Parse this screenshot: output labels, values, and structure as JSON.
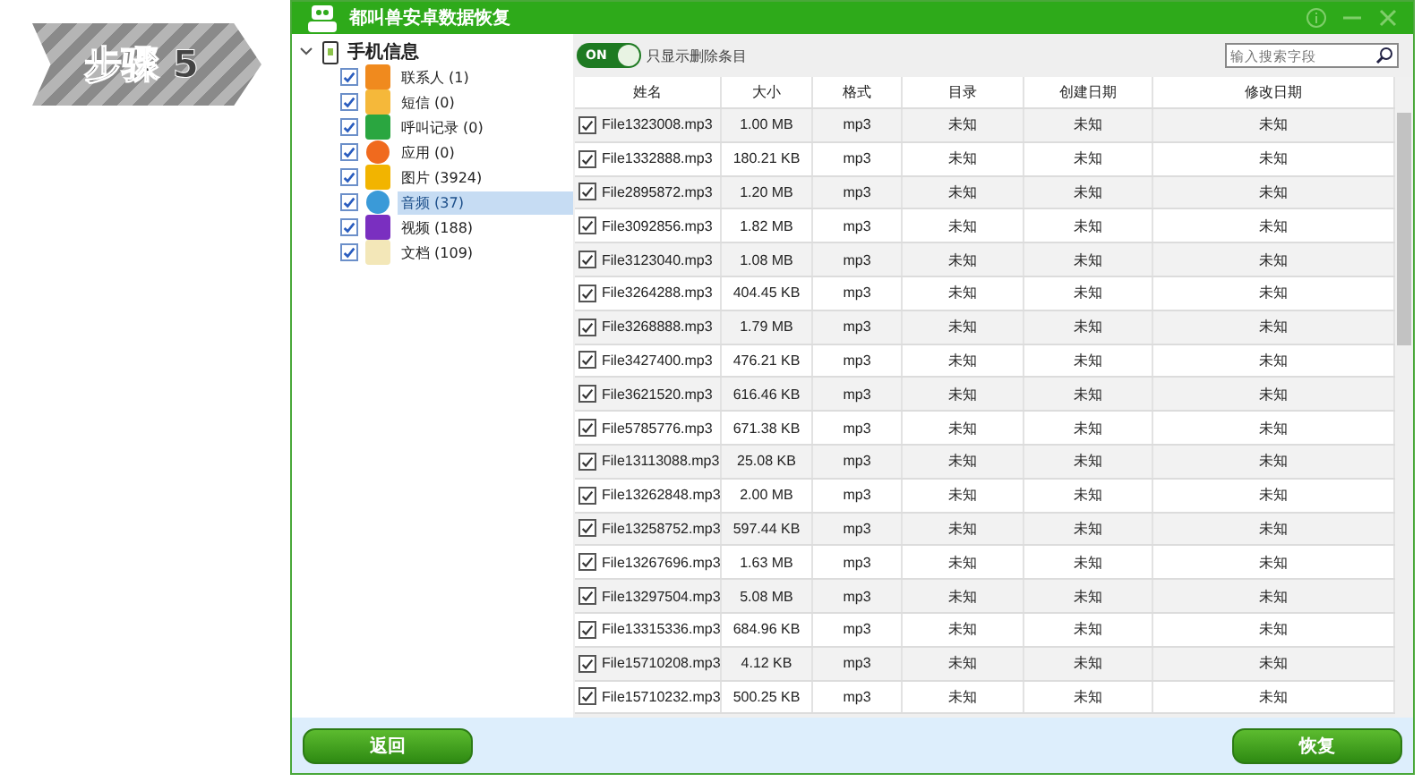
{
  "step_badge": {
    "label": "步骤 5"
  },
  "window": {
    "title": "都叫兽安卓数据恢复"
  },
  "tree": {
    "label": "手机信息",
    "expanded": true,
    "children": [
      {
        "label": "联系人 (1)",
        "kind": "contacts",
        "checked": true,
        "selected": false
      },
      {
        "label": "短信 (0)",
        "kind": "messages",
        "checked": true,
        "selected": false
      },
      {
        "label": "呼叫记录 (0)",
        "kind": "calls",
        "checked": true,
        "selected": false
      },
      {
        "label": "应用 (0)",
        "kind": "apps",
        "checked": true,
        "selected": false
      },
      {
        "label": "图片 (3924)",
        "kind": "photos",
        "checked": true,
        "selected": false
      },
      {
        "label": "音频 (37)",
        "kind": "audio",
        "checked": true,
        "selected": true
      },
      {
        "label": "视频 (188)",
        "kind": "video",
        "checked": true,
        "selected": false
      },
      {
        "label": "文档 (109)",
        "kind": "documents",
        "checked": true,
        "selected": false
      }
    ]
  },
  "filter": {
    "toggle_label": "ON",
    "on": true,
    "label": "只显示删除条目"
  },
  "search": {
    "placeholder": "输入搜索字段"
  },
  "table": {
    "columns": [
      "姓名",
      "大小",
      "格式",
      "目录",
      "创建日期",
      "修改日期"
    ],
    "rows": [
      {
        "checked": true,
        "cells": [
          "File1323008.mp3",
          "1.00 MB",
          "mp3",
          "未知",
          "未知",
          "未知"
        ]
      },
      {
        "checked": true,
        "cells": [
          "File1332888.mp3",
          "180.21 KB",
          "mp3",
          "未知",
          "未知",
          "未知"
        ]
      },
      {
        "checked": true,
        "cells": [
          "File2895872.mp3",
          "1.20 MB",
          "mp3",
          "未知",
          "未知",
          "未知"
        ]
      },
      {
        "checked": true,
        "cells": [
          "File3092856.mp3",
          "1.82 MB",
          "mp3",
          "未知",
          "未知",
          "未知"
        ]
      },
      {
        "checked": true,
        "cells": [
          "File3123040.mp3",
          "1.08 MB",
          "mp3",
          "未知",
          "未知",
          "未知"
        ]
      },
      {
        "checked": true,
        "cells": [
          "File3264288.mp3",
          "404.45 KB",
          "mp3",
          "未知",
          "未知",
          "未知"
        ]
      },
      {
        "checked": true,
        "cells": [
          "File3268888.mp3",
          "1.79 MB",
          "mp3",
          "未知",
          "未知",
          "未知"
        ]
      },
      {
        "checked": true,
        "cells": [
          "File3427400.mp3",
          "476.21 KB",
          "mp3",
          "未知",
          "未知",
          "未知"
        ]
      },
      {
        "checked": true,
        "cells": [
          "File3621520.mp3",
          "616.46 KB",
          "mp3",
          "未知",
          "未知",
          "未知"
        ]
      },
      {
        "checked": true,
        "cells": [
          "File5785776.mp3",
          "671.38 KB",
          "mp3",
          "未知",
          "未知",
          "未知"
        ]
      },
      {
        "checked": true,
        "cells": [
          "File13113088.mp3",
          "25.08 KB",
          "mp3",
          "未知",
          "未知",
          "未知"
        ]
      },
      {
        "checked": true,
        "cells": [
          "File13262848.mp3",
          "2.00 MB",
          "mp3",
          "未知",
          "未知",
          "未知"
        ]
      },
      {
        "checked": true,
        "cells": [
          "File13258752.mp3",
          "597.44 KB",
          "mp3",
          "未知",
          "未知",
          "未知"
        ]
      },
      {
        "checked": true,
        "cells": [
          "File13267696.mp3",
          "1.63 MB",
          "mp3",
          "未知",
          "未知",
          "未知"
        ]
      },
      {
        "checked": true,
        "cells": [
          "File13297504.mp3",
          "5.08 MB",
          "mp3",
          "未知",
          "未知",
          "未知"
        ]
      },
      {
        "checked": true,
        "cells": [
          "File13315336.mp3",
          "684.96 KB",
          "mp3",
          "未知",
          "未知",
          "未知"
        ]
      },
      {
        "checked": true,
        "cells": [
          "File15710208.mp3",
          "4.12 KB",
          "mp3",
          "未知",
          "未知",
          "未知"
        ]
      },
      {
        "checked": true,
        "cells": [
          "File15710232.mp3",
          "500.25 KB",
          "mp3",
          "未知",
          "未知",
          "未知"
        ]
      }
    ]
  },
  "buttons": [
    {
      "label": "返回"
    },
    {
      "label": "恢复"
    }
  ]
}
